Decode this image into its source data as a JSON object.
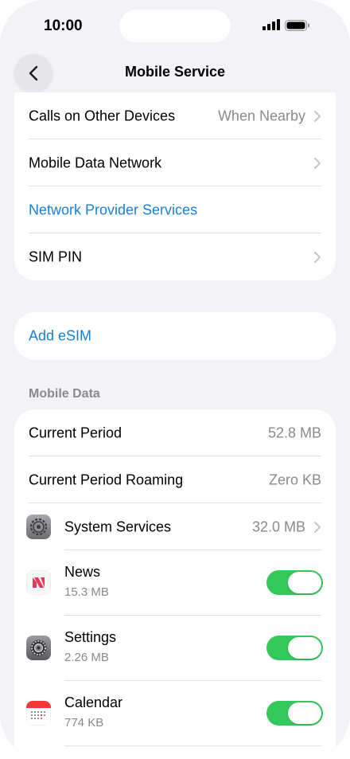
{
  "status": {
    "time": "10:00"
  },
  "nav": {
    "title": "Mobile Service"
  },
  "group1": {
    "rows": [
      {
        "label": "Calls on Other Devices",
        "value": "When Nearby"
      },
      {
        "label": "Mobile Data Network"
      },
      {
        "label": "Network Provider Services"
      },
      {
        "label": "SIM PIN"
      }
    ]
  },
  "group2": {
    "add_esim": "Add eSIM"
  },
  "mobile_data": {
    "header": "Mobile Data",
    "current_period": {
      "label": "Current Period",
      "value": "52.8 MB"
    },
    "current_period_roaming": {
      "label": "Current Period Roaming",
      "value": "Zero KB"
    },
    "system_services": {
      "label": "System Services",
      "value": "32.0 MB"
    },
    "apps": [
      {
        "name": "News",
        "usage": "15.3 MB",
        "enabled": true,
        "icon": "news-icon"
      },
      {
        "name": "Settings",
        "usage": "2.26 MB",
        "enabled": true,
        "icon": "settings-gear-icon"
      },
      {
        "name": "Calendar",
        "usage": "774 KB",
        "enabled": true,
        "icon": "calendar-icon"
      }
    ]
  },
  "colors": {
    "background": "#f2f2f7",
    "link": "#1a7fd4",
    "toggle_on": "#34c759"
  }
}
